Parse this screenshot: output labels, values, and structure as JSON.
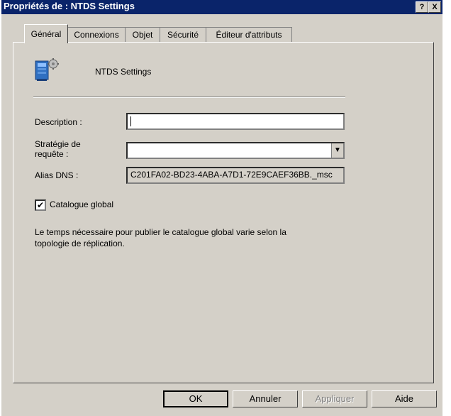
{
  "window": {
    "title": "Propriétés de : NTDS Settings",
    "help_glyph": "?",
    "close_glyph": "X"
  },
  "tabs": [
    {
      "label": "Général",
      "active": true
    },
    {
      "label": "Connexions"
    },
    {
      "label": "Objet"
    },
    {
      "label": "Sécurité"
    },
    {
      "label": "Éditeur d'attributs"
    }
  ],
  "header": {
    "object_name": "NTDS Settings",
    "icon": "ntds-settings-icon"
  },
  "form": {
    "description_label": "Description :",
    "description_value": "",
    "query_policy_label_line1": "Stratégie de",
    "query_policy_label_line2": "requête :",
    "query_policy_value": "",
    "dns_alias_label": "Alias DNS :",
    "dns_alias_value": "C201FA02-BD23-4ABA-A7D1-72E9CAEF36BB._msc",
    "global_catalog_label": "Catalogue global",
    "global_catalog_checked": true,
    "info_line1": "Le temps nécessaire pour publier le catalogue global varie selon la",
    "info_line2": "topologie de réplication."
  },
  "buttons": {
    "ok": "OK",
    "cancel": "Annuler",
    "apply": "Appliquer",
    "help": "Aide"
  },
  "colors": {
    "titlebar": "#0a246a",
    "face": "#d4d0c8"
  }
}
